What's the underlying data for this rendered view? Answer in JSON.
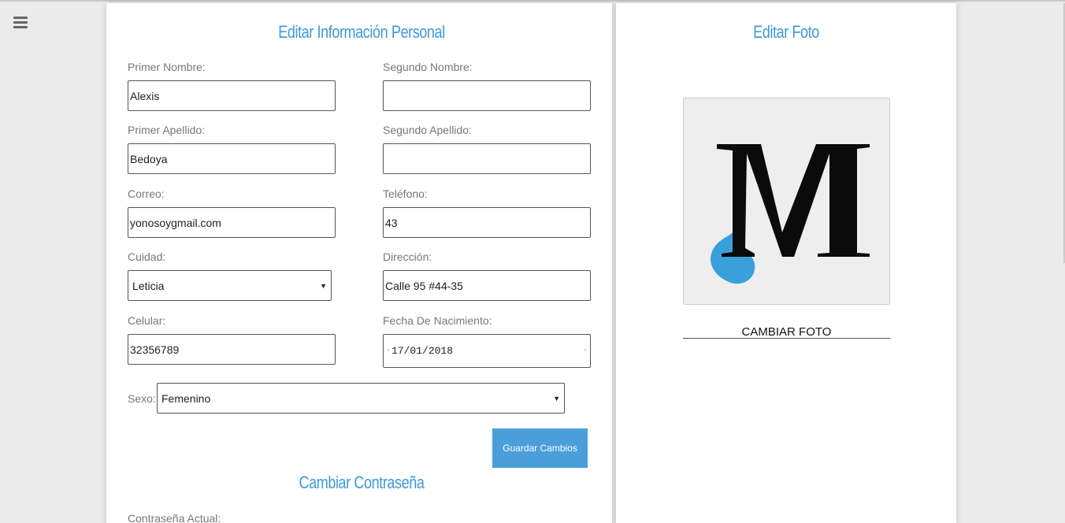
{
  "nav": {
    "menu_icon": "hamburger-menu-icon"
  },
  "personal": {
    "title": "Editar Información Personal",
    "primer_nombre": {
      "label": "Primer Nombre:",
      "value": "Alexis"
    },
    "segundo_nombre": {
      "label": "Segundo Nombre:",
      "value": ""
    },
    "primer_apellido": {
      "label": "Primer Apellido:",
      "value": "Bedoya"
    },
    "segundo_apellido": {
      "label": "Segundo Apellido:",
      "value": ""
    },
    "correo": {
      "label": "Correo:",
      "value": "yonosoygmail.com"
    },
    "telefono": {
      "label": "Teléfono:",
      "value": "43"
    },
    "ciudad": {
      "label": "Cuidad:",
      "value": "Leticia"
    },
    "direccion": {
      "label": "Dirección:",
      "value": "Calle 95 #44-35"
    },
    "celular": {
      "label": "Celular:",
      "value": "32356789"
    },
    "fecha": {
      "label": "Fecha De Nacimiento:",
      "value": "17/01/2018"
    },
    "sexo": {
      "label": "Sexo:",
      "value": "Femenino"
    },
    "save_label": "Guardar Cambios"
  },
  "password": {
    "title": "Cambiar Contraseña",
    "actual_label": "Contraseña Actual:"
  },
  "photo": {
    "title": "Editar Foto",
    "change_label": "CAMBIAR FOTO",
    "logo_letter": "M",
    "accent_color": "#3aa0db"
  }
}
